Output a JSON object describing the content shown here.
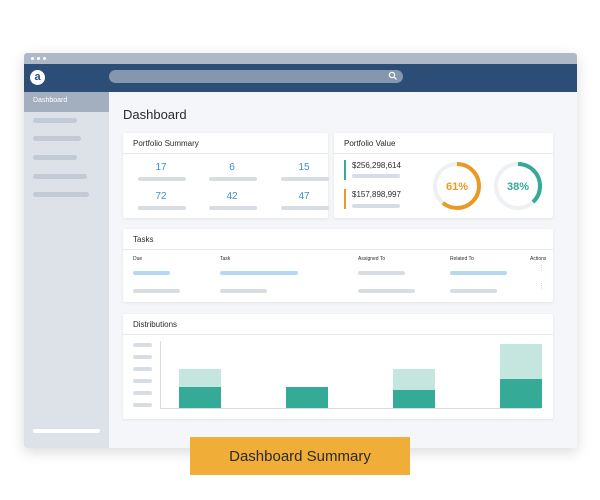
{
  "window": {
    "sidebar": {
      "active_item": "Dashboard"
    },
    "logo_glyph": "a"
  },
  "page": {
    "title": "Dashboard"
  },
  "portfolio_summary": {
    "title": "Portfolio Summary",
    "values": [
      "17",
      "6",
      "15",
      "72",
      "42",
      "47"
    ]
  },
  "portfolio_value": {
    "title": "Portfolio Value",
    "amounts": [
      "$256,298,614",
      "$157,898,997"
    ],
    "gauges": [
      {
        "percent": 61,
        "label": "61%",
        "color": "#e89a24"
      },
      {
        "percent": 38,
        "label": "38%",
        "color": "#34aa97"
      }
    ]
  },
  "tasks": {
    "title": "Tasks",
    "columns": [
      "Due",
      "Task",
      "Assigned To",
      "Related To",
      "Actions"
    ]
  },
  "distributions": {
    "title": "Distributions",
    "bars": [
      {
        "light": 0.58,
        "dark": 0.32
      },
      {
        "light": 0.3,
        "dark": 0.32
      },
      {
        "light": 0.58,
        "dark": 0.27
      },
      {
        "light": 0.96,
        "dark": 0.44
      }
    ]
  },
  "summary_button": {
    "label": "Dashboard Summary"
  },
  "colors": {
    "navy": "#2c4d75",
    "accent_blue": "#3a8fd0",
    "orange": "#e89a24",
    "teal": "#34aa97",
    "button_yellow": "#f0ad37"
  }
}
